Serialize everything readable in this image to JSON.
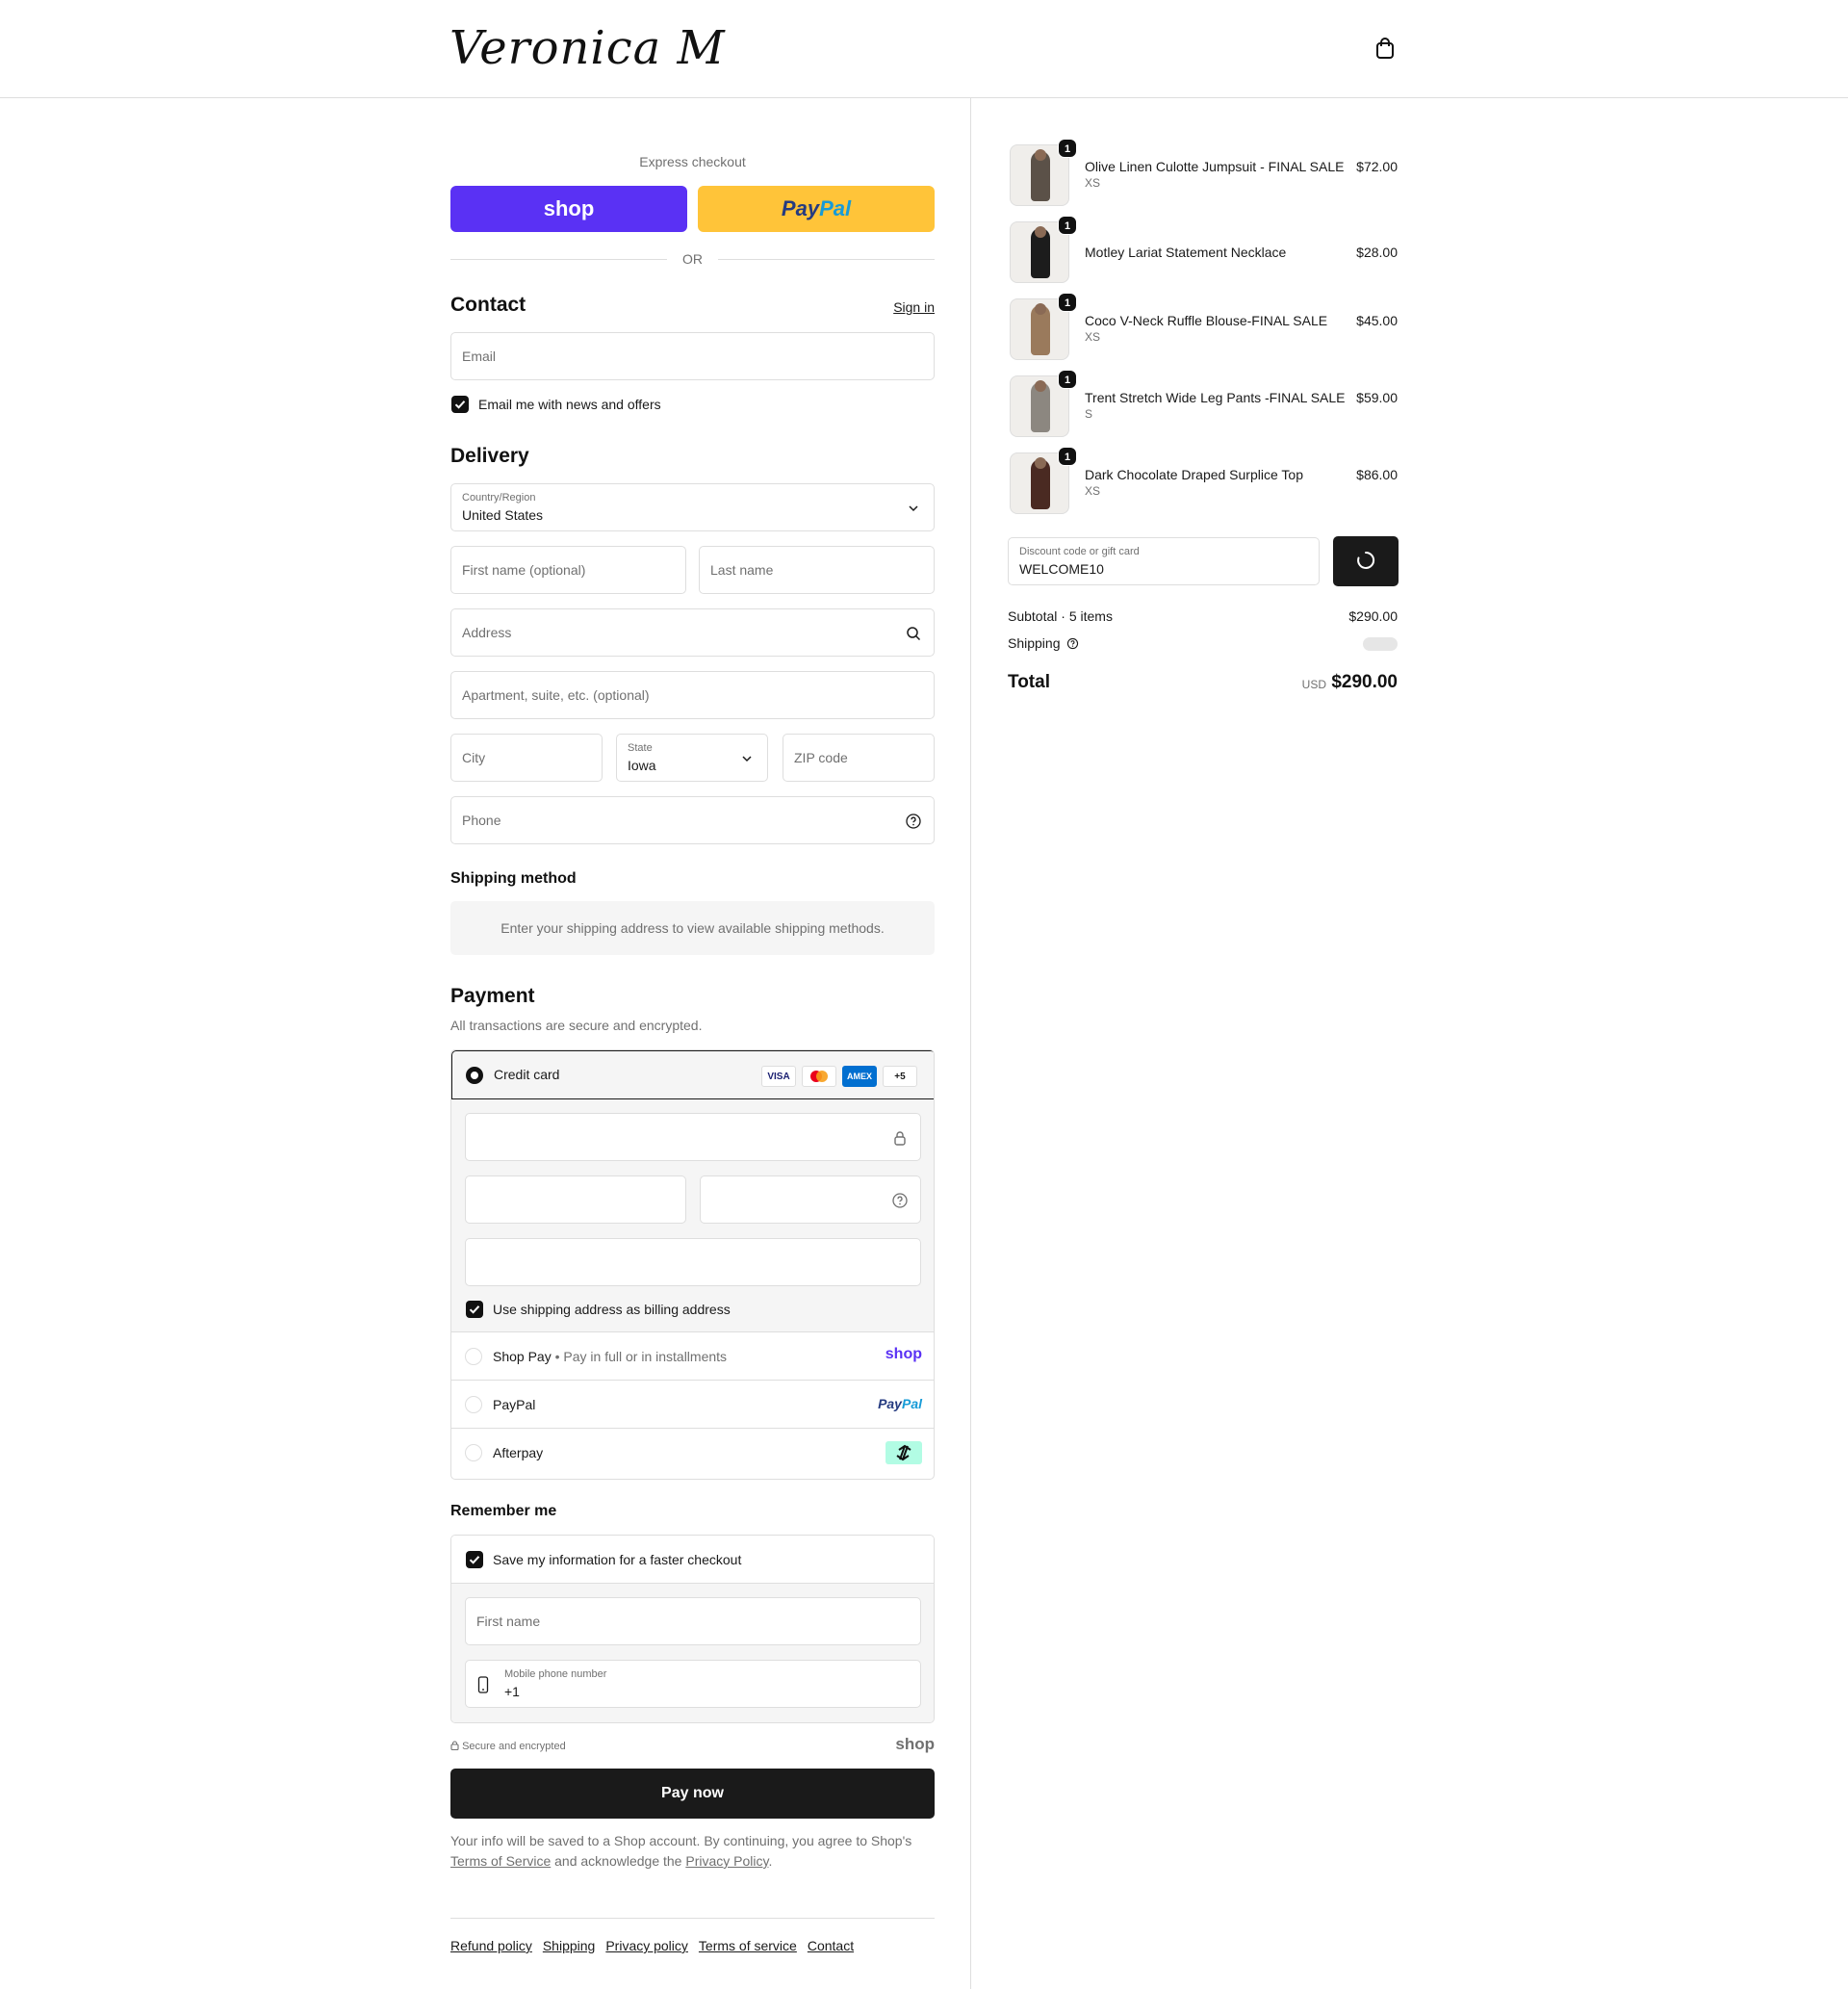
{
  "header": {
    "logo": "Veronica M"
  },
  "express": {
    "label": "Express checkout",
    "shop_button": "shop",
    "paypal_button_1": "Pay",
    "paypal_button_2": "Pal",
    "or_label": "OR"
  },
  "contact": {
    "title": "Contact",
    "sign_in": "Sign in",
    "email_placeholder": "Email",
    "news_label": "Email me with news and offers"
  },
  "delivery": {
    "title": "Delivery",
    "country_label": "Country/Region",
    "country_value": "United States",
    "first_name_placeholder": "First name (optional)",
    "last_name_placeholder": "Last name",
    "address_placeholder": "Address",
    "apartment_placeholder": "Apartment, suite, etc. (optional)",
    "city_placeholder": "City",
    "state_label": "State",
    "state_value": "Iowa",
    "zip_placeholder": "ZIP code",
    "phone_placeholder": "Phone"
  },
  "shipping_method": {
    "title": "Shipping method",
    "message": "Enter your shipping address to view available shipping methods."
  },
  "payment": {
    "title": "Payment",
    "subtitle": "All transactions are secure and encrypted.",
    "credit_card_label": "Credit card",
    "card_badges": [
      "VISA",
      "",
      "AMEX",
      "+5"
    ],
    "billing_label": "Use shipping address as billing address",
    "shop_pay_label": "Shop Pay",
    "shop_pay_sub": "Pay in full or in installments",
    "shop_pay_logo": "shop",
    "paypal_label": "PayPal",
    "paypal_logo_1": "Pay",
    "paypal_logo_2": "Pal",
    "afterpay_label": "Afterpay"
  },
  "remember": {
    "title": "Remember me",
    "save_label": "Save my information for a faster checkout",
    "first_name_placeholder": "First name",
    "mobile_label": "Mobile phone number",
    "mobile_value": "+1"
  },
  "footer": {
    "secure_label": "Secure and encrypted",
    "shop_mark": "shop",
    "pay_now": "Pay now",
    "legal_1": "Your info will be saved to a Shop account. By continuing, you agree to Shop's ",
    "legal_tos": "Terms of Service",
    "legal_2": " and acknowledge the ",
    "legal_privacy": "Privacy Policy",
    "legal_3": ".",
    "links": [
      "Refund policy",
      "Shipping",
      "Privacy policy",
      "Terms of service",
      "Contact"
    ]
  },
  "summary": {
    "items": [
      {
        "name": "Olive Linen Culotte Jumpsuit - FINAL SALE",
        "variant": "XS",
        "price": "$72.00",
        "qty": "1",
        "color": "#5b5148"
      },
      {
        "name": "Motley Lariat Statement Necklace",
        "variant": "",
        "price": "$28.00",
        "qty": "1",
        "color": "#1c1c1c"
      },
      {
        "name": "Coco V-Neck Ruffle Blouse-FINAL SALE",
        "variant": "XS",
        "price": "$45.00",
        "qty": "1",
        "color": "#9a7a5c"
      },
      {
        "name": "Trent Stretch Wide Leg Pants -FINAL SALE",
        "variant": "S",
        "price": "$59.00",
        "qty": "1",
        "color": "#8c8780"
      },
      {
        "name": "Dark Chocolate Draped Surplice Top",
        "variant": "XS",
        "price": "$86.00",
        "qty": "1",
        "color": "#4a2a22"
      }
    ],
    "discount_label": "Discount code or gift card",
    "discount_value": "WELCOME10",
    "subtotal_label": "Subtotal · 5 items",
    "subtotal_value": "$290.00",
    "shipping_label": "Shipping",
    "total_label": "Total",
    "total_currency": "USD",
    "total_value": "$290.00"
  }
}
